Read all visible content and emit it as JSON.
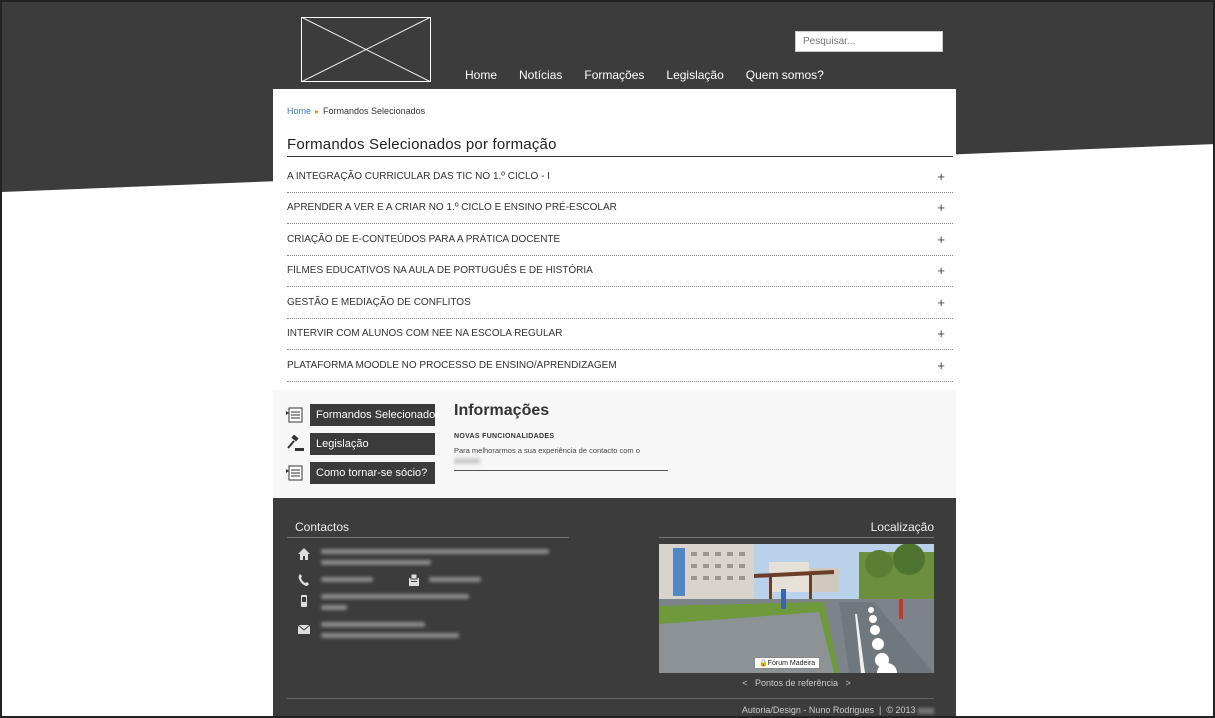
{
  "header": {
    "nav": [
      "Home",
      "Notícias",
      "Formações",
      "Legislação",
      "Quem somos?"
    ],
    "search_placeholder": "Pesquisar..."
  },
  "breadcrumb": {
    "home": "Home",
    "current": "Formandos Selecionados"
  },
  "page_title": "Formandos Selecionados por formação",
  "courses": [
    "A INTEGRAÇÃO CURRICULAR DAS TIC NO 1.º CICLO - I",
    "APRENDER A VER E A CRIAR NO 1.º CICLO E ENSINO PRÉ-ESCOLAR",
    "CRIAÇÃO DE E-CONTEÚDOS PARA A PRÁTICA DOCENTE",
    "FILMES EDUCATIVOS NA AULA DE PORTUGUÊS E DE HISTÓRIA",
    "GESTÃO E MEDIAÇÃO DE CONFLITOS",
    "INTERVIR COM ALUNOS COM NEE NA ESCOLA REGULAR",
    "PLATAFORMA MOODLE NO PROCESSO DE ENSINO/APRENDIZAGEM"
  ],
  "expand_symbol": "+",
  "side_links": [
    "Formandos Selecionados",
    "Legislação",
    "Como tornar-se sócio?"
  ],
  "info": {
    "title": "Informações",
    "subtitle": "NOVAS FUNCIONALIDADES",
    "text": "Para melhorarmos a sua experiência de contacto com o"
  },
  "footer": {
    "contacts_title": "Contactos",
    "location_title": "Localização",
    "map_tag": "Fórum Madeira",
    "refs_prev": "<",
    "refs_label": "Pontos de referência",
    "refs_next": ">",
    "credits": "Autoria/Design - Nuno Rodrigues",
    "credits_sep": "|",
    "copyright": "© 2013"
  },
  "icons": {
    "contacts": [
      "home-icon",
      "phone-icon",
      "fax-icon",
      "mobile-icon",
      "mail-icon"
    ],
    "side": [
      "document-icon",
      "gavel-icon",
      "document-icon"
    ]
  },
  "colors": {
    "dark": "#3c3c3c",
    "accent_link": "#3a7ac0",
    "breadcrumb_arrow": "#e09020"
  }
}
